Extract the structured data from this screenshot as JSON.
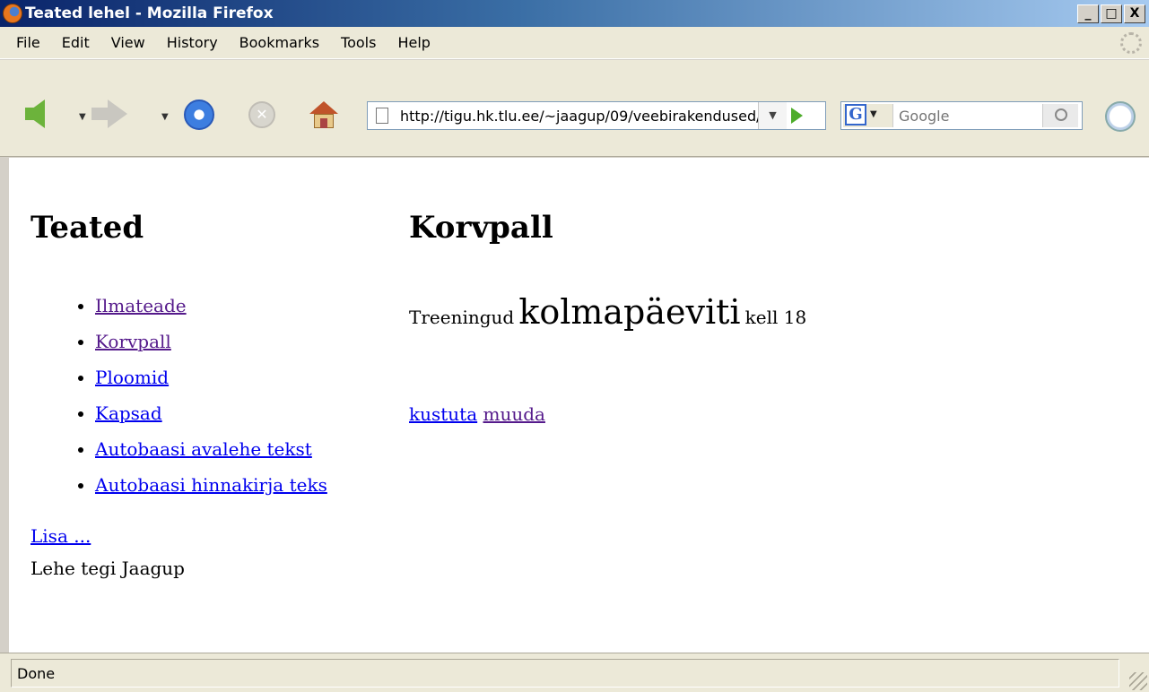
{
  "window": {
    "title": "Teated lehel - Mozilla Firefox",
    "buttons": [
      "_",
      "□",
      "X"
    ]
  },
  "menu": {
    "items": [
      "File",
      "Edit",
      "View",
      "History",
      "Bookmarks",
      "Tools",
      "Help"
    ]
  },
  "toolbar": {
    "url": "http://tigu.hk.tlu.ee/~jaagup/09/veebirakendused/...",
    "search_placeholder": "Google"
  },
  "page": {
    "left_heading": "Teated",
    "nav_links": [
      {
        "label": "Ilmateade",
        "visited": true
      },
      {
        "label": "Korvpall",
        "visited": true
      },
      {
        "label": "Ploomid",
        "visited": false
      },
      {
        "label": "Kapsad",
        "visited": false
      },
      {
        "label": "Autobaasi avalehe tekst",
        "visited": false
      },
      {
        "label": "Autobaasi hinnakirja teks",
        "visited": false
      }
    ],
    "add_link": "Lisa ...",
    "author_text": "Lehe tegi Jaagup",
    "right_heading": "Korvpall",
    "message": {
      "part1": "Treeningud",
      "part2": "kolmapäeviti",
      "part3": "kell 18"
    },
    "actions": {
      "delete": "kustuta",
      "edit": "muuda"
    }
  },
  "status": {
    "text": "Done"
  }
}
